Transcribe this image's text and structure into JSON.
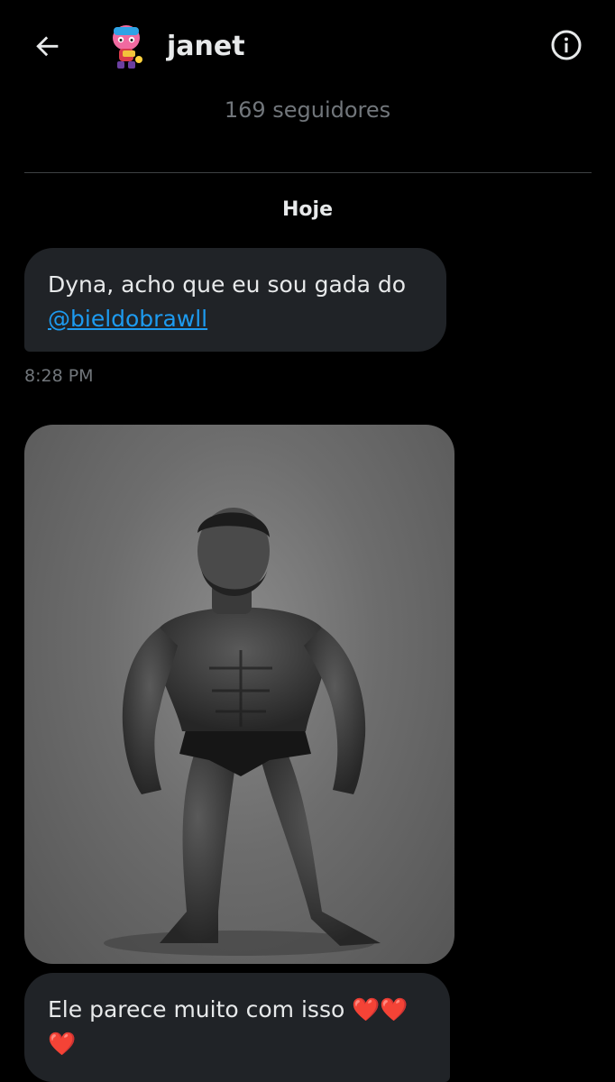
{
  "header": {
    "back_icon": "arrow-left-icon",
    "username": "janet",
    "info_icon": "info-circle-icon",
    "followers": "169 seguidores"
  },
  "conversation": {
    "date_label": "Hoje",
    "messages": [
      {
        "text": "Dyna, acho que eu sou gada do",
        "mention": "@bieldobrawll",
        "time": "8:28 PM"
      },
      {
        "media": "muscular-man-photo",
        "text": "Ele parece muito com isso",
        "emoji": "❤️❤️❤️"
      }
    ]
  },
  "colors": {
    "background": "#000000",
    "bubble": "#202327",
    "link": "#1d9bf0",
    "secondary_text": "#71767b",
    "heart": "#f4212e"
  }
}
